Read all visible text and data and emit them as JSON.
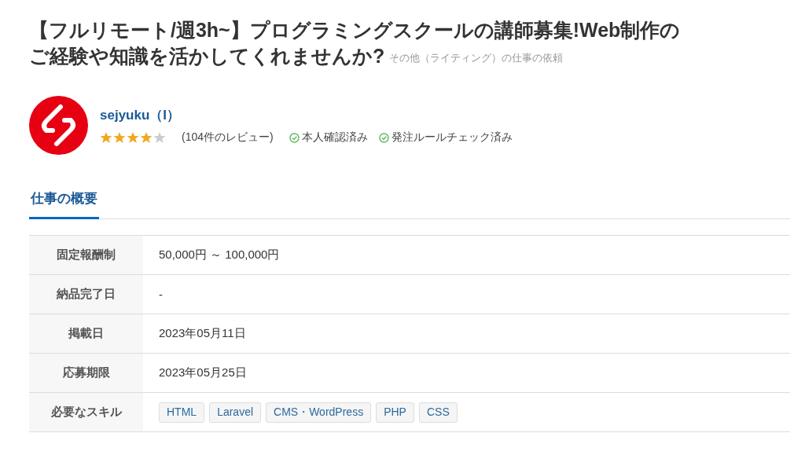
{
  "title_lines": [
    "【フルリモート/週3h~】プログラミングスクールの講師募集!Web制作の",
    "ご経験や知識を活かしてくれませんか?"
  ],
  "category": "その他（ライティング）の仕事の依頼",
  "client": {
    "name": "sejyuku（I）",
    "stars": 4,
    "reviews": "(104件のレビュー)",
    "badges": [
      {
        "label": "本人確認済み",
        "checked": true
      },
      {
        "label": "発注ルールチェック済み",
        "checked": true
      }
    ]
  },
  "tabs": [
    {
      "label": "仕事の概要",
      "selected": true
    }
  ],
  "rows": [
    {
      "label": "固定報酬制",
      "kind": "text",
      "value": "50,000円 ～ 100,000円"
    },
    {
      "label": "納品完了日",
      "kind": "text",
      "value": "-"
    },
    {
      "label": "掲載日",
      "kind": "text",
      "value": "2023年05月11日"
    },
    {
      "label": "応募期限",
      "kind": "text",
      "value": "2023年05月25日"
    },
    {
      "label": "必要なスキル",
      "kind": "tags",
      "tags": [
        "HTML",
        "Laravel",
        "CMS・WordPress",
        "PHP",
        "CSS"
      ]
    }
  ]
}
